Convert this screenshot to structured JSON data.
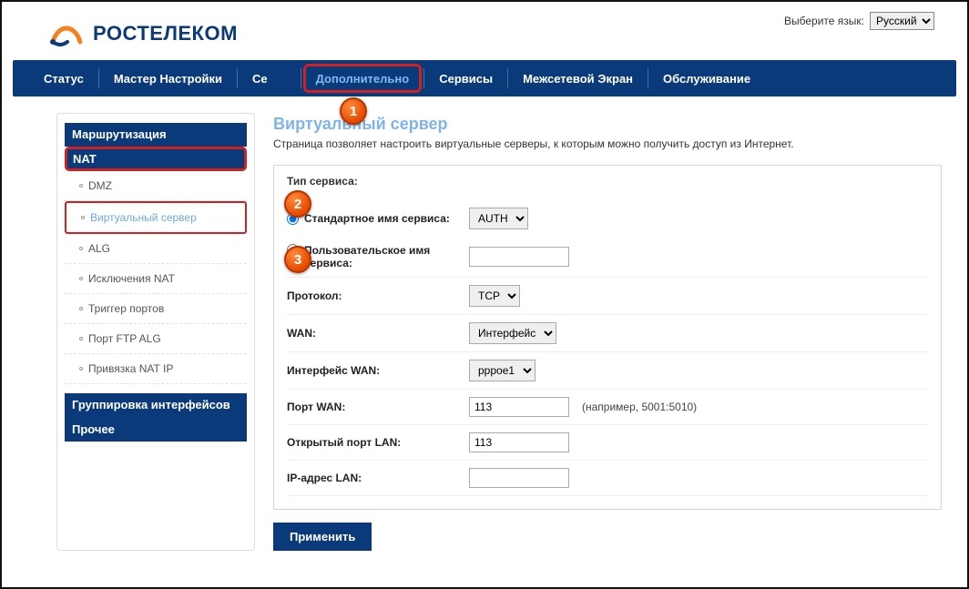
{
  "lang": {
    "label": "Выберите язык:",
    "selected": "Русский"
  },
  "brand": "РОСТЕЛЕКОМ",
  "nav": {
    "status": "Статус",
    "wizard": "Мастер Настройки",
    "network": "Се",
    "advanced": "Дополнительно",
    "services": "Сервисы",
    "firewall": "Межсетевой Экран",
    "maintenance": "Обслуживание"
  },
  "sidebar": {
    "routing": "Маршрутизация",
    "nat": "NAT",
    "nat_items": {
      "dmz": "DMZ",
      "vserver": "Виртуальный сервер",
      "alg": "ALG",
      "natexc": "Исключения NAT",
      "trigger": "Триггер портов",
      "ftpalg": "Порт FTP ALG",
      "natip": "Привязка NAT IP"
    },
    "ifgroup": "Группировка интерфейсов",
    "other": "Прочее"
  },
  "page": {
    "title": "Виртуальный сервер",
    "desc": "Страница позволяет настроить виртуальные серверы, к которым можно получить доступ из Интернет."
  },
  "form": {
    "service_type": "Тип сервиса:",
    "std_name": "Стандартное имя сервиса:",
    "std_sel": "AUTH",
    "custom_name": "Пользовательское имя сервиса:",
    "custom_val": "",
    "protocol": "Протокол:",
    "protocol_val": "TCP",
    "wan": "WAN:",
    "wan_val": "Интерфейс",
    "wan_if": "Интерфейс WAN:",
    "wan_if_val": "pppoe1",
    "wan_port": "Порт WAN:",
    "wan_port_val": "113",
    "wan_port_hint": "(например, 5001:5010)",
    "open_port": "Открытый порт LAN:",
    "open_port_val": "113",
    "lan_ip": "IP-адрес LAN:",
    "lan_ip_val": "",
    "apply": "Применить"
  },
  "badges": {
    "b1": "1",
    "b2": "2",
    "b3": "3"
  }
}
